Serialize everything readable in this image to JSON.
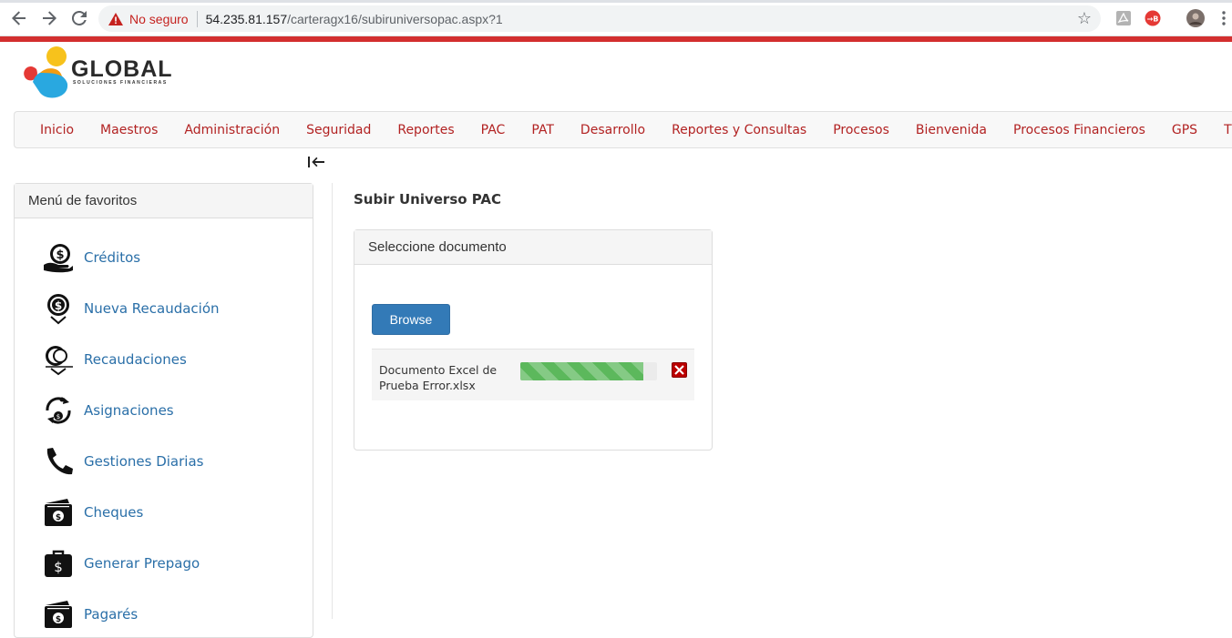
{
  "browser": {
    "security_label": "No seguro",
    "url_host": "54.235.81.157",
    "url_path": "/carteragx16/subiruniversopac.aspx?1"
  },
  "logo": {
    "name": "GLOBAL",
    "tagline": "SOLUCIONES FINANCIERAS"
  },
  "nav": {
    "items": [
      "Inicio",
      "Maestros",
      "Administración",
      "Seguridad",
      "Reportes",
      "PAC",
      "PAT",
      "Desarrollo",
      "Reportes y Consultas",
      "Procesos",
      "Bienvenida",
      "Procesos Financieros",
      "GPS",
      "TMC"
    ]
  },
  "sidebar": {
    "title": "Menú de favoritos",
    "items": [
      {
        "label": "Créditos",
        "icon": "money-hand-icon"
      },
      {
        "label": "Nueva Recaudación",
        "icon": "coin-down-icon"
      },
      {
        "label": "Recaudaciones",
        "icon": "coins-down-icon"
      },
      {
        "label": "Asignaciones",
        "icon": "refresh-money-icon"
      },
      {
        "label": "Gestiones Diarias",
        "icon": "phone-icon"
      },
      {
        "label": "Cheques",
        "icon": "wallet-icon"
      },
      {
        "label": "Generar Prepago",
        "icon": "briefcase-money-icon"
      },
      {
        "label": "Pagarés",
        "icon": "wallet-icon"
      }
    ]
  },
  "content": {
    "page_title": "Subir Universo PAC",
    "panel_title": "Seleccione documento",
    "browse_label": "Browse",
    "file": {
      "name": "Documento Excel de Prueba Error.xlsx",
      "progress_percent": 90
    }
  },
  "colors": {
    "accent_red": "#d32f2f",
    "nav_text": "#b22222",
    "link_blue": "#2a6fa8",
    "button_blue": "#337ab7",
    "progress_green": "#5cb85c"
  }
}
